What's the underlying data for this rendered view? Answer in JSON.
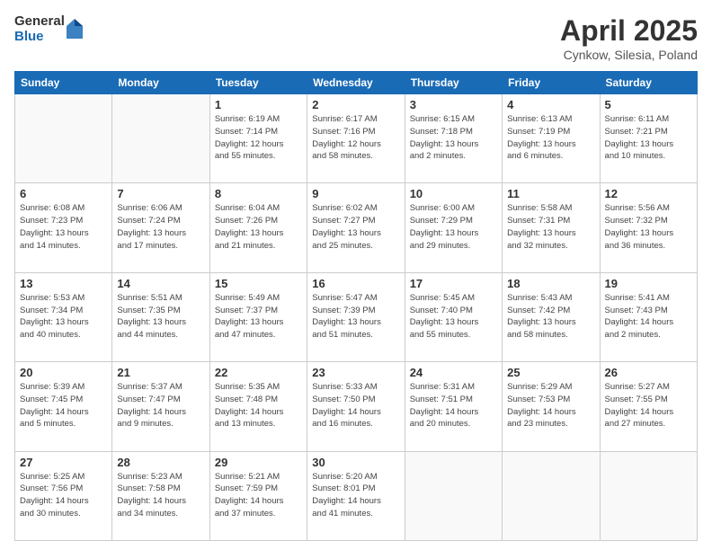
{
  "logo": {
    "general": "General",
    "blue": "Blue"
  },
  "title": "April 2025",
  "subtitle": "Cynkow, Silesia, Poland",
  "days_of_week": [
    "Sunday",
    "Monday",
    "Tuesday",
    "Wednesday",
    "Thursday",
    "Friday",
    "Saturday"
  ],
  "weeks": [
    [
      {
        "day": "",
        "info": ""
      },
      {
        "day": "",
        "info": ""
      },
      {
        "day": "1",
        "info": "Sunrise: 6:19 AM\nSunset: 7:14 PM\nDaylight: 12 hours\nand 55 minutes."
      },
      {
        "day": "2",
        "info": "Sunrise: 6:17 AM\nSunset: 7:16 PM\nDaylight: 12 hours\nand 58 minutes."
      },
      {
        "day": "3",
        "info": "Sunrise: 6:15 AM\nSunset: 7:18 PM\nDaylight: 13 hours\nand 2 minutes."
      },
      {
        "day": "4",
        "info": "Sunrise: 6:13 AM\nSunset: 7:19 PM\nDaylight: 13 hours\nand 6 minutes."
      },
      {
        "day": "5",
        "info": "Sunrise: 6:11 AM\nSunset: 7:21 PM\nDaylight: 13 hours\nand 10 minutes."
      }
    ],
    [
      {
        "day": "6",
        "info": "Sunrise: 6:08 AM\nSunset: 7:23 PM\nDaylight: 13 hours\nand 14 minutes."
      },
      {
        "day": "7",
        "info": "Sunrise: 6:06 AM\nSunset: 7:24 PM\nDaylight: 13 hours\nand 17 minutes."
      },
      {
        "day": "8",
        "info": "Sunrise: 6:04 AM\nSunset: 7:26 PM\nDaylight: 13 hours\nand 21 minutes."
      },
      {
        "day": "9",
        "info": "Sunrise: 6:02 AM\nSunset: 7:27 PM\nDaylight: 13 hours\nand 25 minutes."
      },
      {
        "day": "10",
        "info": "Sunrise: 6:00 AM\nSunset: 7:29 PM\nDaylight: 13 hours\nand 29 minutes."
      },
      {
        "day": "11",
        "info": "Sunrise: 5:58 AM\nSunset: 7:31 PM\nDaylight: 13 hours\nand 32 minutes."
      },
      {
        "day": "12",
        "info": "Sunrise: 5:56 AM\nSunset: 7:32 PM\nDaylight: 13 hours\nand 36 minutes."
      }
    ],
    [
      {
        "day": "13",
        "info": "Sunrise: 5:53 AM\nSunset: 7:34 PM\nDaylight: 13 hours\nand 40 minutes."
      },
      {
        "day": "14",
        "info": "Sunrise: 5:51 AM\nSunset: 7:35 PM\nDaylight: 13 hours\nand 44 minutes."
      },
      {
        "day": "15",
        "info": "Sunrise: 5:49 AM\nSunset: 7:37 PM\nDaylight: 13 hours\nand 47 minutes."
      },
      {
        "day": "16",
        "info": "Sunrise: 5:47 AM\nSunset: 7:39 PM\nDaylight: 13 hours\nand 51 minutes."
      },
      {
        "day": "17",
        "info": "Sunrise: 5:45 AM\nSunset: 7:40 PM\nDaylight: 13 hours\nand 55 minutes."
      },
      {
        "day": "18",
        "info": "Sunrise: 5:43 AM\nSunset: 7:42 PM\nDaylight: 13 hours\nand 58 minutes."
      },
      {
        "day": "19",
        "info": "Sunrise: 5:41 AM\nSunset: 7:43 PM\nDaylight: 14 hours\nand 2 minutes."
      }
    ],
    [
      {
        "day": "20",
        "info": "Sunrise: 5:39 AM\nSunset: 7:45 PM\nDaylight: 14 hours\nand 5 minutes."
      },
      {
        "day": "21",
        "info": "Sunrise: 5:37 AM\nSunset: 7:47 PM\nDaylight: 14 hours\nand 9 minutes."
      },
      {
        "day": "22",
        "info": "Sunrise: 5:35 AM\nSunset: 7:48 PM\nDaylight: 14 hours\nand 13 minutes."
      },
      {
        "day": "23",
        "info": "Sunrise: 5:33 AM\nSunset: 7:50 PM\nDaylight: 14 hours\nand 16 minutes."
      },
      {
        "day": "24",
        "info": "Sunrise: 5:31 AM\nSunset: 7:51 PM\nDaylight: 14 hours\nand 20 minutes."
      },
      {
        "day": "25",
        "info": "Sunrise: 5:29 AM\nSunset: 7:53 PM\nDaylight: 14 hours\nand 23 minutes."
      },
      {
        "day": "26",
        "info": "Sunrise: 5:27 AM\nSunset: 7:55 PM\nDaylight: 14 hours\nand 27 minutes."
      }
    ],
    [
      {
        "day": "27",
        "info": "Sunrise: 5:25 AM\nSunset: 7:56 PM\nDaylight: 14 hours\nand 30 minutes."
      },
      {
        "day": "28",
        "info": "Sunrise: 5:23 AM\nSunset: 7:58 PM\nDaylight: 14 hours\nand 34 minutes."
      },
      {
        "day": "29",
        "info": "Sunrise: 5:21 AM\nSunset: 7:59 PM\nDaylight: 14 hours\nand 37 minutes."
      },
      {
        "day": "30",
        "info": "Sunrise: 5:20 AM\nSunset: 8:01 PM\nDaylight: 14 hours\nand 41 minutes."
      },
      {
        "day": "",
        "info": ""
      },
      {
        "day": "",
        "info": ""
      },
      {
        "day": "",
        "info": ""
      }
    ]
  ]
}
